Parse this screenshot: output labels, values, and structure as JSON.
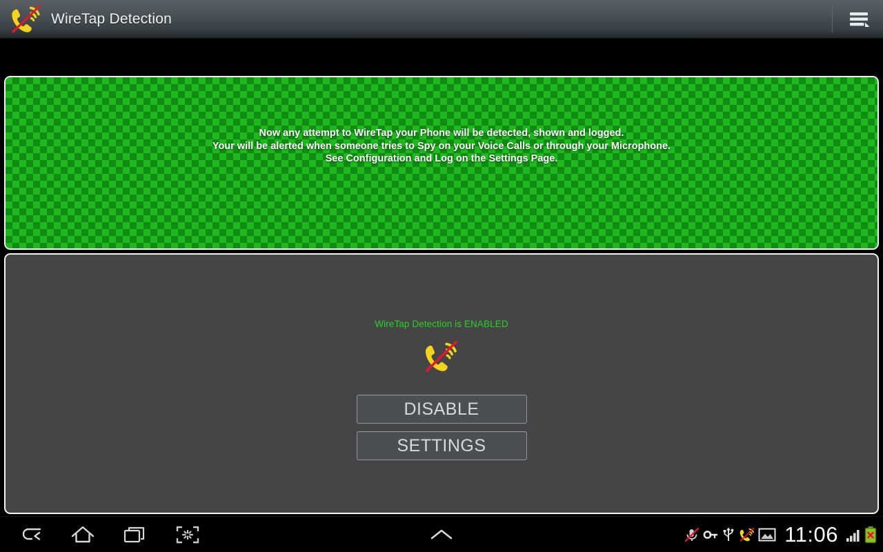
{
  "app": {
    "title": "WireTap Detection",
    "icon": "wiretap-blocked-phone-icon",
    "menu_icon": "hamburger-menu-icon"
  },
  "info_panel": {
    "background_color": "#1fb81f",
    "lines": [
      "Now any attempt to WireTap your Phone will be detected, shown and logged.",
      "Your will be alerted when someone tries to Spy on your Voice Calls or through your Microphone.",
      "See Configuration and Log on the Settings Page."
    ]
  },
  "control_panel": {
    "status_text": "WireTap Detection is ENABLED",
    "status_color": "#27d327",
    "icon": "wiretap-blocked-phone-icon",
    "buttons": [
      {
        "label": "DISABLE",
        "name": "disable-button"
      },
      {
        "label": "SETTINGS",
        "name": "settings-button"
      }
    ]
  },
  "navbar": {
    "back_icon": "back-arrow-icon",
    "home_icon": "home-icon",
    "recents_icon": "recent-apps-icon",
    "screenshot_icon": "screenshot-capture-icon",
    "expand_icon": "chevron-up-icon",
    "status_icons": [
      "microphone-muted-icon",
      "vpn-key-icon",
      "usb-icon",
      "wiretap-app-notification-icon",
      "screenshot-saved-icon"
    ],
    "clock": "11:06",
    "signal_icon": "signal-bars-icon",
    "battery_icon": "battery-error-icon"
  }
}
